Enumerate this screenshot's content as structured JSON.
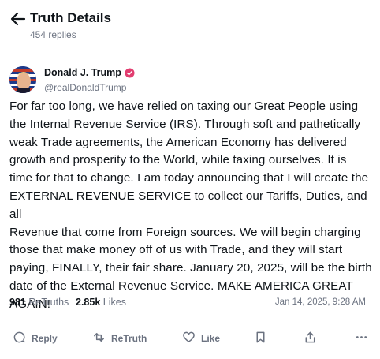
{
  "header": {
    "title": "Truth Details",
    "replies": "454 replies"
  },
  "author": {
    "name": "Donald J. Trump",
    "handle": "@realDonaldTrump"
  },
  "post": {
    "text": "For far too long, we have relied on taxing our Great People using\nthe Internal Revenue Service (IRS). Through soft and pathetically\nweak Trade agreements, the American Economy has delivered\ngrowth and prosperity to the World, while taxing ourselves. It is\ntime for that to change. I am today announcing that I will create the\nEXTERNAL REVENUE SERVICE to collect our Tariffs, Duties, and all\nRevenue that come from Foreign sources. We will begin charging\nthose that make money off of us with Trade, and they will start\npaying, FINALLY, their fair share. January 20, 2025, will be the birth\ndate of the External Revenue Service. MAKE AMERICA GREAT\nAGAIN!"
  },
  "stats": {
    "retruths_count": "981",
    "retruths_label": "ReTruths",
    "likes_count": "2.85k",
    "likes_label": "Likes",
    "timestamp": "Jan 14, 2025, 9:28 AM"
  },
  "actions": {
    "reply": "Reply",
    "retruth": "ReTruth",
    "like": "Like"
  },
  "colors": {
    "accent": "#e23d70",
    "muted": "#6b7280",
    "text": "#0f1419"
  }
}
